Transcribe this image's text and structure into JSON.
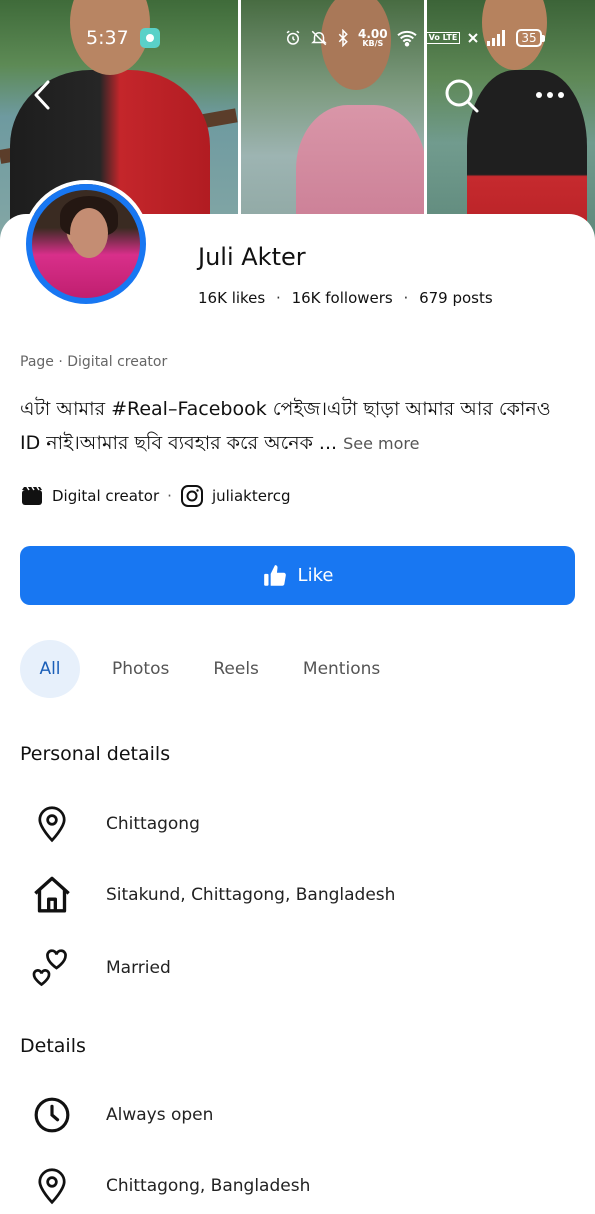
{
  "status_bar": {
    "time": "5:37",
    "net_speed_value": "4.00",
    "net_speed_unit": "KB/S",
    "network_tag": "Vo LTE",
    "battery": "35"
  },
  "profile": {
    "name": "Juli Akter",
    "stats": {
      "likes": "16K likes",
      "followers": "16K followers",
      "posts": "679 posts",
      "separator": "·"
    },
    "category_line": "Page · Digital creator",
    "bio": "এটা আমার #Real–Facebook পেইজ।এটা ছাড়া আমার আর কোনও ID নাই।আমার ছবি ব্যবহার করে অনেক ...",
    "see_more": "See more",
    "chips": {
      "category": "Digital creator",
      "separator": "·",
      "instagram": "juliaktercg"
    },
    "like_label": "Like"
  },
  "tabs": [
    "All",
    "Photos",
    "Reels",
    "Mentions"
  ],
  "personal_details": {
    "title": "Personal details",
    "items": [
      {
        "icon": "location-pin-icon",
        "text": "Chittagong"
      },
      {
        "icon": "home-icon",
        "text": "Sitakund, Chittagong, Bangladesh"
      },
      {
        "icon": "hearts-icon",
        "text": "Married"
      }
    ]
  },
  "details": {
    "title": "Details",
    "items": [
      {
        "icon": "clock-icon",
        "text": "Always open"
      },
      {
        "icon": "location-pin-icon",
        "text": "Chittagong, Bangladesh"
      }
    ]
  },
  "colors": {
    "brand_blue": "#1877f2",
    "active_tab_bg": "#e7f0fb",
    "active_tab_text": "#1b5fb8"
  }
}
